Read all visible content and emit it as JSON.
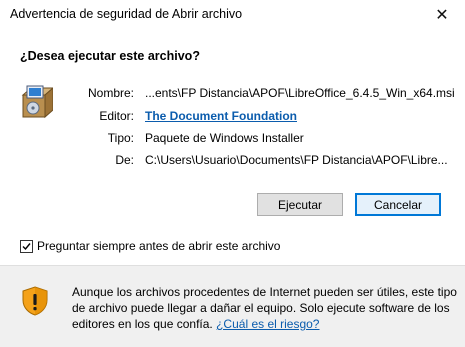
{
  "window": {
    "title": "Advertencia de seguridad de Abrir archivo",
    "close_glyph": "✕"
  },
  "dialog": {
    "question": "¿Desea ejecutar este archivo?",
    "fields": [
      {
        "label": "Nombre:",
        "value": "...ents\\FP Distancia\\APOF\\LibreOffice_6.4.5_Win_x64.msi"
      },
      {
        "label": "Editor:",
        "value": "The Document Foundation"
      },
      {
        "label": "Tipo:",
        "value": "Paquete de Windows Installer"
      },
      {
        "label": "De:",
        "value": "C:\\Users\\Usuario\\Documents\\FP Distancia\\APOF\\Libre..."
      }
    ],
    "buttons": {
      "run": "Ejecutar",
      "cancel": "Cancelar"
    },
    "checkbox": {
      "label": "Preguntar siempre antes de abrir este archivo",
      "checked": true
    }
  },
  "warning": {
    "text": "Aunque los archivos procedentes de Internet pueden ser útiles, este tipo de archivo puede llegar a dañar el equipo. Solo ejecute software de los editores en los que confía. ",
    "link": "¿Cuál es el riesgo?"
  },
  "colors": {
    "link": "#0b5cad",
    "default_button_border": "#0078d7",
    "footer_bg": "#f0f0f0"
  },
  "icons": {
    "package": "installer-package-icon",
    "warning": "security-shield-warning-icon"
  }
}
